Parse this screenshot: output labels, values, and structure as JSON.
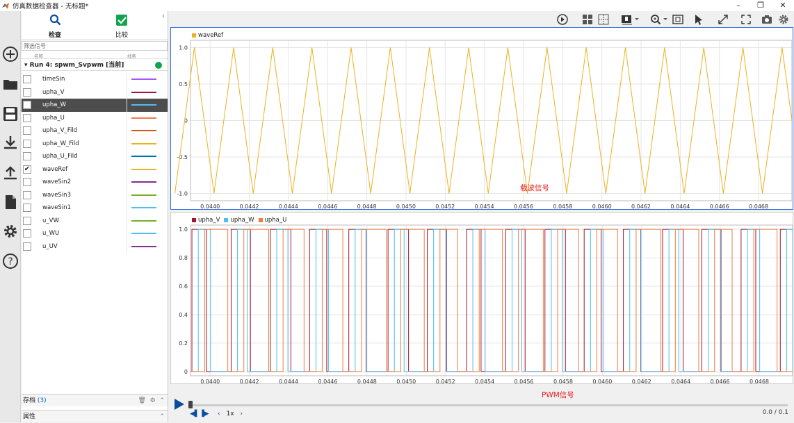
{
  "window": {
    "title": "仿真数据检查器 - 无标题*",
    "buttons": [
      "–",
      "❐",
      "✕"
    ]
  },
  "sidebar": {
    "icons": [
      "add-icon",
      "folder-icon",
      "save-icon",
      "download-icon",
      "upload-icon",
      "document-icon",
      "gear-icon",
      "help-icon"
    ]
  },
  "panel": {
    "tabs": [
      {
        "label": "检查",
        "icon": "search-icon",
        "active": true
      },
      {
        "label": "比较",
        "icon": "check-icon",
        "active": false
      }
    ],
    "collapse": "‹",
    "filter_placeholder": "筛选信号",
    "col_name": "名称",
    "col_line": "线条",
    "run": {
      "label": "Run 4: spwm_Svpwm [当前]",
      "status_color": "#12a44c"
    },
    "signals": [
      {
        "name": "timeSin",
        "color": "#a855f7",
        "checked": false,
        "selected": false
      },
      {
        "name": "upha_V",
        "color": "#a2142f",
        "checked": false,
        "selected": false
      },
      {
        "name": "upha_W",
        "color": "#4dbeee",
        "checked": false,
        "selected": true
      },
      {
        "name": "upha_U",
        "color": "#f07b3f",
        "checked": false,
        "selected": false
      },
      {
        "name": "upha_V_Fild",
        "color": "#d95319",
        "checked": false,
        "selected": false
      },
      {
        "name": "upha_W_Fild",
        "color": "#edb120",
        "checked": false,
        "selected": false
      },
      {
        "name": "upha_U_Fild",
        "color": "#0072bd",
        "checked": false,
        "selected": false
      },
      {
        "name": "waveRef",
        "color": "#edb120",
        "checked": true,
        "selected": false
      },
      {
        "name": "waveSin2",
        "color": "#7e2f8e",
        "checked": false,
        "selected": false
      },
      {
        "name": "waveSin3",
        "color": "#77ac30",
        "checked": false,
        "selected": false
      },
      {
        "name": "waveSin1",
        "color": "#4dbeee",
        "checked": false,
        "selected": false
      },
      {
        "name": "u_VW",
        "color": "#77ac30",
        "checked": false,
        "selected": false
      },
      {
        "name": "u_WU",
        "color": "#4dbeee",
        "checked": false,
        "selected": false
      },
      {
        "name": "u_UV",
        "color": "#7e2f8e",
        "checked": false,
        "selected": false
      }
    ],
    "archive_label": "存档",
    "archive_count": "(3)",
    "properties_label": "属性"
  },
  "toolbar": {
    "icons": [
      "play-record-icon",
      "layout-grid-icon",
      "subplot-layout-icon",
      "legend-icon",
      "zoom-icon",
      "fit-view-icon",
      "cursor-icon",
      "expand-icon",
      "fullscreen-icon",
      "snapshot-icon",
      "settings-icon"
    ]
  },
  "chart_data": [
    {
      "type": "line",
      "legend": [
        "waveRef"
      ],
      "series": [
        {
          "name": "waveRef",
          "color": "#edb120",
          "shape": "triangle",
          "period": 0.0002,
          "amplitude": 1.0,
          "first_peak": 0.04412
        }
      ],
      "xlim": [
        0.0439,
        0.04697
      ],
      "ylim": [
        -1.1,
        1.1
      ],
      "xticks": [
        "0.0440",
        "0.0442",
        "0.0444",
        "0.0446",
        "0.0448",
        "0.0450",
        "0.0452",
        "0.0454",
        "0.0456",
        "0.0458",
        "0.0460",
        "0.0462",
        "0.0464",
        "0.0466",
        "0.0468"
      ],
      "yticks": [
        "1.0",
        "0.5",
        "0",
        "-0.5",
        "-1.0"
      ],
      "ytick_values": [
        1.0,
        0.5,
        0,
        -0.5,
        -1.0
      ],
      "annotation": "载波信号",
      "grid": true
    },
    {
      "type": "line",
      "legend": [
        "upha_V",
        "upha_W",
        "upha_U"
      ],
      "series": [
        {
          "name": "upha_V",
          "color": "#a2142f",
          "step": true,
          "values": [
            0,
            1
          ]
        },
        {
          "name": "upha_W",
          "color": "#4dbeee",
          "step": true,
          "values": [
            0,
            1
          ]
        },
        {
          "name": "upha_U",
          "color": "#f07b3f",
          "step": true,
          "values": [
            0,
            1
          ]
        }
      ],
      "xlim": [
        0.0439,
        0.04697
      ],
      "ylim": [
        -0.03,
        1.03
      ],
      "xticks": [
        "0.0440",
        "0.0442",
        "0.0444",
        "0.0446",
        "0.0448",
        "0.0450",
        "0.0452",
        "0.0454",
        "0.0456",
        "0.0458",
        "0.0460",
        "0.0462",
        "0.0464",
        "0.0466",
        "0.0468"
      ],
      "yticks": [
        "1.0",
        "0.8",
        "0.6",
        "0.4",
        "0.2",
        "0"
      ],
      "ytick_values": [
        1.0,
        0.8,
        0.6,
        0.4,
        0.2,
        0
      ],
      "annotation": "PWM信号",
      "grid": true
    }
  ],
  "timeline": {
    "speed": "1x",
    "time": "0.0 / 0.1"
  }
}
